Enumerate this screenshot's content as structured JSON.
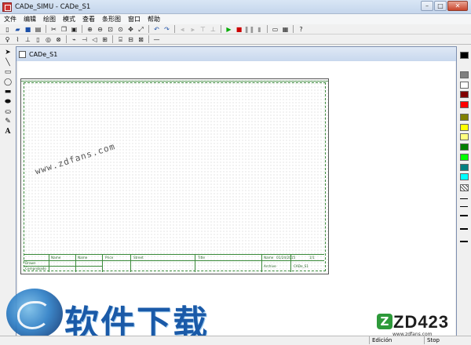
{
  "window": {
    "title": "CADe_SIMU - CADe_S1"
  },
  "menu": [
    "文件",
    "编辑",
    "绘图",
    "模式",
    "查看",
    "条形图",
    "窗口",
    "帮助"
  ],
  "document": {
    "tab_title": "CADe_S1"
  },
  "watermark_text": "www.zdfans.com",
  "title_block": {
    "name_label_1": "Name",
    "name_label_2": "Name",
    "price_label": "Price",
    "street_label": "Street",
    "title_label": "Title",
    "drawn_label": "Drawn",
    "comprobado_label": "Comprobado",
    "name_label_3": "Name",
    "date_value": "01/24/2015",
    "sheet_value": "1/1",
    "sheet_label": "Sheet",
    "file_value": "CADe_S1",
    "archive_label": "Archive"
  },
  "status": {
    "edition": "Edición",
    "stop": "Stop"
  },
  "branding": {
    "left_logo_text": "软件下载",
    "right_logo_text": "ZD423",
    "right_badge": "Z",
    "right_url": "www.zdfans.com"
  },
  "palette_colors": [
    "#000000",
    "#808080",
    "#c0c0c0",
    "#ffffff",
    "#800000",
    "#ff0000",
    "#808000",
    "#ffff00",
    "#ffff80",
    "#008000",
    "#00ff00",
    "#008080",
    "#00ffff",
    "#000080",
    "#0000ff"
  ],
  "icons": {
    "toolbar1": [
      "new-icon",
      "open-icon",
      "save-icon",
      "print-icon",
      "cut-icon",
      "copy-icon",
      "paste-icon",
      "zoom-in-icon",
      "zoom-out-icon",
      "zoom-window-icon",
      "zoom-all-icon",
      "pan-icon",
      "undo-icon",
      "redo-icon",
      "play-icon",
      "stop-icon",
      "pause-icon",
      "step-icon",
      "window-icon",
      "help-icon"
    ],
    "left_tools": [
      "select-arrow-icon",
      "line-icon",
      "rectangle-icon",
      "ellipse-icon",
      "filled-rectangle-icon",
      "filled-ellipse-icon",
      "fill-bucket-icon",
      "pen-icon",
      "text-icon"
    ]
  }
}
